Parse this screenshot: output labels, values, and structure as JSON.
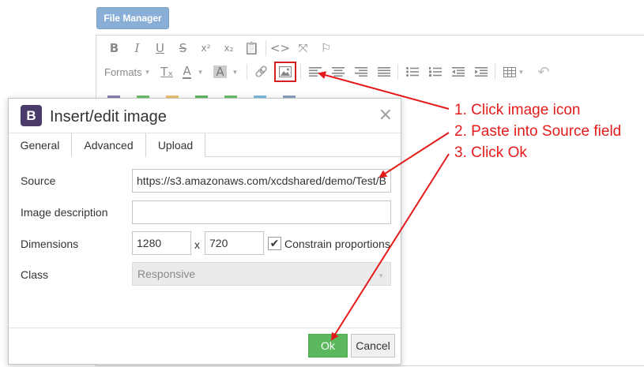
{
  "file_manager": {
    "label": "File Manager"
  },
  "toolbar": {
    "row1": [
      {
        "name": "bold-button",
        "glyph": "B",
        "cls": "bold"
      },
      {
        "name": "italic-button",
        "glyph": "I",
        "cls": "italic"
      },
      {
        "name": "underline-button",
        "glyph": "U",
        "cls": "under"
      },
      {
        "name": "strikethrough-button",
        "glyph": "S",
        "cls": "strike"
      },
      {
        "name": "superscript-button",
        "glyph": "x²",
        "cls": ""
      },
      {
        "name": "subscript-button",
        "glyph": "x₂",
        "cls": ""
      },
      {
        "name": "paste-icon",
        "glyph": "📋",
        "cls": ""
      },
      {
        "name": "code-icon",
        "glyph": "<>",
        "cls": ""
      },
      {
        "name": "fullscreen-icon",
        "glyph": "⤧",
        "cls": ""
      },
      {
        "name": "bookmark-icon",
        "glyph": "⚐",
        "cls": ""
      }
    ],
    "formats_label": "Formats",
    "clear_format_glyph": "Tₓ",
    "text_color_glyph": "A",
    "bg_color_glyph": "A",
    "link_glyph": "🔗",
    "align_left_glyph": "≡",
    "align_center_glyph": "≡",
    "align_right_glyph": "≡",
    "justify_glyph": "≡",
    "bullet_list_glyph": "☰",
    "numbered_list_glyph": "☰",
    "outdent_glyph": "⇤",
    "indent_glyph": "⇥",
    "table_glyph": "▦",
    "undo_glyph": "↶",
    "row3_swatches": [
      "#8a7fb0",
      "#6bbf6b",
      "#f0c070",
      "#5cb85c",
      "#6bbf6b",
      "#7ab8e0",
      "#8aa0c0"
    ]
  },
  "dialog": {
    "logo": "B",
    "title": "Insert/edit image",
    "close": "×",
    "tabs": [
      "General",
      "Advanced",
      "Upload"
    ],
    "source_label": "Source",
    "source_value": "https://s3.amazonaws.com/xcdshared/demo/Test/B",
    "description_label": "Image description",
    "description_value": "",
    "dimensions_label": "Dimensions",
    "width_value": "1280",
    "times": "x",
    "height_value": "720",
    "constrain_label": "Constrain proportions",
    "constrain_check": "✔",
    "class_label": "Class",
    "class_value": "Responsive",
    "ok_label": "Ok",
    "cancel_label": "Cancel"
  },
  "annotations": {
    "step1": "1. Click image icon",
    "step2": "2. Paste into Source field",
    "step3": "3. Click Ok",
    "color": "#e41b1b"
  }
}
